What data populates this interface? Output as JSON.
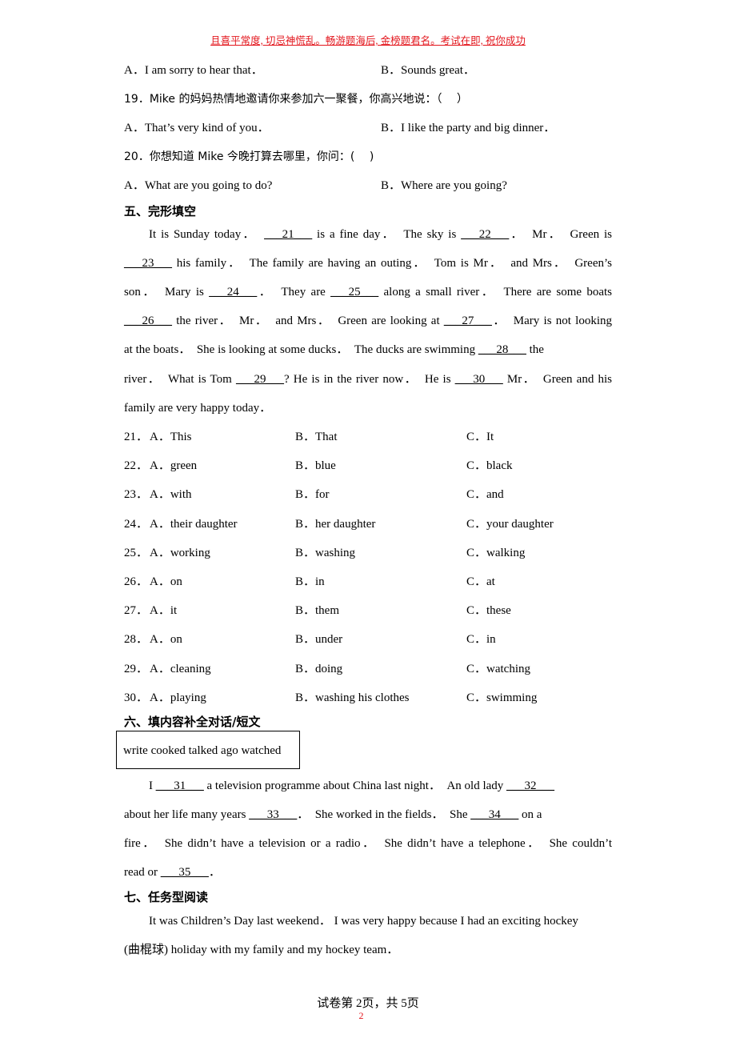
{
  "header": {
    "motto": "且喜平常度, 切忌神慌乱。畅游题海后, 金榜题君名。考试在即, 祝你成功"
  },
  "q18_options": {
    "a": "A．I am sorry to hear that．",
    "b": "B．Sounds great．"
  },
  "q19": {
    "stem": "19．Mike 的妈妈热情地邀请你来参加六一聚餐，你高兴地说：（　 ）",
    "a": "A．That’s very kind of you．",
    "b": "B．I like the party and big dinner．"
  },
  "q20": {
    "stem": "20．你想知道 Mike 今晚打算去哪里，你问：(　 )",
    "a": "A．What are you going to do?",
    "b": "B．Where are you going?"
  },
  "section5": {
    "title": "五、完形填空",
    "passage_lines": [
      [
        "It is Sunday today．　",
        "___21___",
        " is a fine day．　The sky is ",
        "___22___",
        "．　Mr．　Green is"
      ],
      [
        "",
        "___23___",
        " his family．　The family are having an outing．　Tom is Mr．　and Mrs．　Green’s"
      ],
      [
        "son．　Mary is ",
        "___24___",
        "．　They are ",
        "___25___",
        " along a small river．　There are some boats"
      ],
      [
        "",
        "___26___",
        " the river．　Mr．　and Mrs．　Green are looking at ",
        "___27___",
        "．　Mary is not looking"
      ],
      [
        "at the boats．　She is looking at some ducks．　The ducks are swimming ",
        "___28___",
        " the"
      ],
      [
        "river．　What is Tom ",
        "___29___",
        "? He is in the river now．　He is ",
        "___30___",
        " Mr．　Green and his"
      ],
      [
        "family are very happy today．"
      ]
    ],
    "questions": [
      {
        "num": "21．",
        "a": "A．This",
        "b": "B．That",
        "c": "C．It"
      },
      {
        "num": "22．",
        "a": "A．green",
        "b": "B．blue",
        "c": "C．black"
      },
      {
        "num": "23．",
        "a": "A．with",
        "b": "B．for",
        "c": "C．and"
      },
      {
        "num": "24．",
        "a": "A．their daughter",
        "b": "B．her daughter",
        "c": "C．your daughter"
      },
      {
        "num": "25．",
        "a": "A．working",
        "b": "B．washing",
        "c": "C．walking"
      },
      {
        "num": "26．",
        "a": "A．on",
        "b": "B．in",
        "c": "C．at"
      },
      {
        "num": "27．",
        "a": "A．it",
        "b": "B．them",
        "c": "C．these"
      },
      {
        "num": "28．",
        "a": "A．on",
        "b": "B．under",
        "c": "C．in"
      },
      {
        "num": "29．",
        "a": "A．cleaning",
        "b": "B．doing",
        "c": "C．watching"
      },
      {
        "num": "30．",
        "a": "A．playing",
        "b": "B．washing his clothes",
        "c": "C．swimming"
      }
    ]
  },
  "section6": {
    "title": "六、填内容补全对话/短文",
    "word_box": "write cooked talked ago watched",
    "passage_lines": [
      [
        "I ",
        "___31___",
        " a television programme about China last night．　An old lady ",
        "___32___",
        ""
      ],
      [
        "about her life many years ",
        "___33___",
        "．　She worked in the fields．　She ",
        "___34___",
        " on a"
      ],
      [
        "fire．　She didn’t have a television or a radio．　She didn’t have a telephone．　She couldn’t"
      ],
      [
        "read or ",
        "___35___",
        "．"
      ]
    ]
  },
  "section7": {
    "title": "七、任务型阅读",
    "passage_lines": [
      "It was Children’s Day last weekend．  I was very happy because I had an exciting hockey",
      "(曲棍球) holiday with my family and my hockey team．"
    ]
  },
  "footer": {
    "prefix": "试卷第 2",
    "overlay": "2",
    "suffix": "页，共 5页"
  },
  "colors": {
    "header_red": "#e3161d",
    "text": "#000000"
  }
}
